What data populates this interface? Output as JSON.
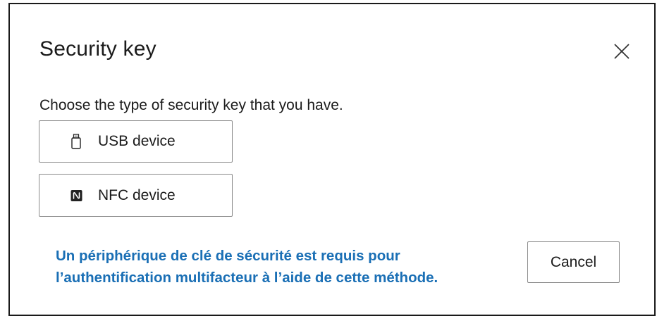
{
  "dialog": {
    "title": "Security key",
    "close_icon": "close-icon",
    "prompt": "Choose the type of security key that you have.",
    "options": [
      {
        "label": "USB device",
        "icon": "usb-drive-icon"
      },
      {
        "label": "NFC device",
        "icon": "nfc-icon"
      }
    ],
    "note": "Un périphérique de clé de sécurité est requis pour l’authentification multifacteur à l’aide de cette méthode.",
    "cancel_label": "Cancel"
  },
  "colors": {
    "note_text": "#1a6fb5",
    "border": "#1a1a1a",
    "button_border": "#8a8a8a"
  }
}
